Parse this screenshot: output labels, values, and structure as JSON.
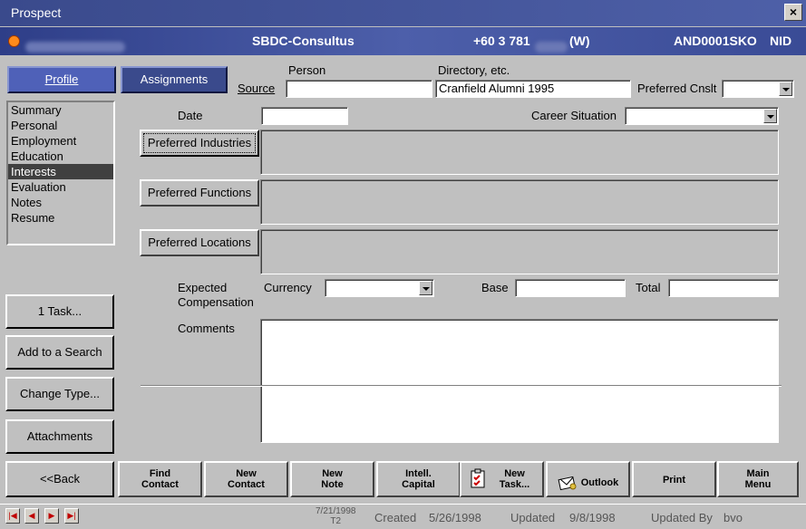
{
  "window": {
    "title": "Prospect",
    "close_label": "×"
  },
  "header": {
    "center_name": "SBDC-Consultus",
    "phone_prefix": "+60 3 781",
    "phone_suffix": "(W)",
    "record_id": "AND0001SKO",
    "flag": "NID"
  },
  "tabs": {
    "profile": "Profile",
    "assignments": "Assignments"
  },
  "nav": {
    "items": [
      "Summary",
      "Personal",
      "Employment",
      "Education",
      "Interests",
      "Evaluation",
      "Notes",
      "Resume"
    ],
    "selected_index": 4
  },
  "source": {
    "label": "Source",
    "person_header": "Person",
    "directory_header": "Directory, etc.",
    "person_value": "",
    "directory_value": "Cranfield Alumni 1995",
    "preferred_cnslt_label": "Preferred Cnslt",
    "preferred_cnslt_value": ""
  },
  "form": {
    "date_label": "Date",
    "date_value": "",
    "career_situation_label": "Career Situation",
    "career_situation_value": "",
    "preferred_industries_button": "Preferred Industries",
    "preferred_functions_button": "Preferred Functions",
    "preferred_locations_button": "Preferred Locations",
    "expected_label_1": "Expected",
    "expected_label_2": "Compensation",
    "currency_label": "Currency",
    "currency_value": "",
    "base_label": "Base",
    "base_value": "",
    "total_label": "Total",
    "total_value": "",
    "comments_label": "Comments",
    "comments_value": ""
  },
  "side_buttons": {
    "task": "1 Task...",
    "add_search": "Add to a Search",
    "change_type": "Change Type...",
    "attachments": "Attachments"
  },
  "bottom_buttons": {
    "back": "<<Back",
    "find_contact_1": "Find",
    "find_contact_2": "Contact",
    "new_contact_1": "New",
    "new_contact_2": "Contact",
    "new_note_1": "New",
    "new_note_2": "Note",
    "intell_capital_1": "Intell.",
    "intell_capital_2": "Capital",
    "new_task_1": "New",
    "new_task_2": "Task...",
    "outlook": "Outlook",
    "print": "Print",
    "main_menu_1": "Main",
    "main_menu_2": "Menu"
  },
  "status": {
    "date_top": "7/21/1998",
    "date_bottom": "T2",
    "created_label": "Created",
    "created_value": "5/26/1998",
    "updated_label": "Updated",
    "updated_value": "9/8/1998",
    "updated_by_label": "Updated By",
    "updated_by_value": "bvo"
  },
  "colors": {
    "titlebar": "#3a4a8c",
    "header": "#4d5faa",
    "panel": "#c0c0c0",
    "accent_orange": "#ff8a1a",
    "record_nav_red": "#c00000"
  }
}
